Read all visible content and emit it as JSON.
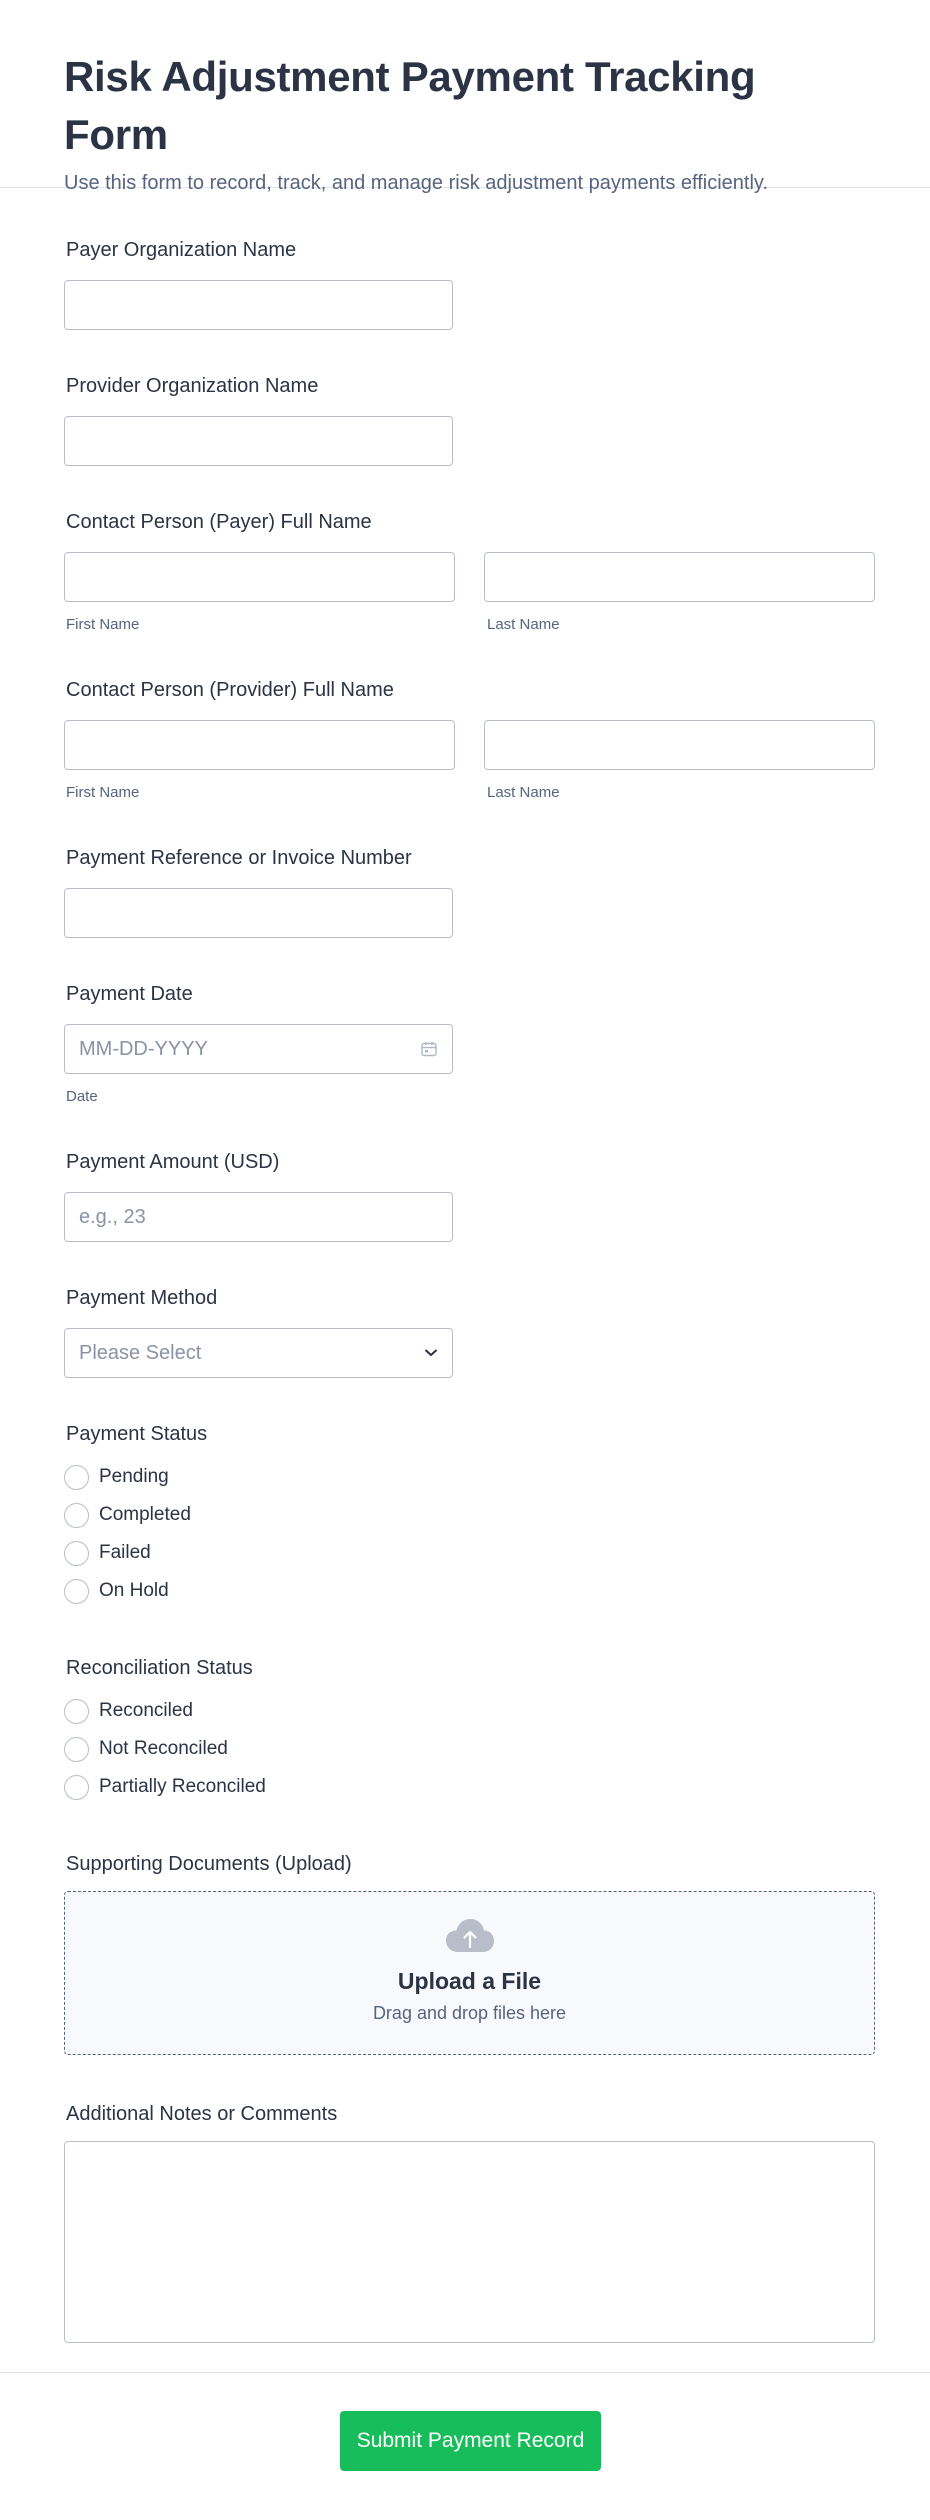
{
  "header": {
    "title": "Risk Adjustment Payment Tracking Form",
    "subtitle": "Use this form to record, track, and manage risk adjustment payments efficiently."
  },
  "fields": {
    "payer_org": {
      "label": "Payer Organization Name",
      "value": ""
    },
    "provider_org": {
      "label": "Provider Organization Name",
      "value": ""
    },
    "payer_contact": {
      "label": "Contact Person (Payer) Full Name",
      "first_sublabel": "First Name",
      "last_sublabel": "Last Name"
    },
    "provider_contact": {
      "label": "Contact Person (Provider) Full Name",
      "first_sublabel": "First Name",
      "last_sublabel": "Last Name"
    },
    "reference": {
      "label": "Payment Reference or Invoice Number",
      "value": ""
    },
    "payment_date": {
      "label": "Payment Date",
      "placeholder": "MM-DD-YYYY",
      "sublabel": "Date",
      "icon": "calendar-icon"
    },
    "amount": {
      "label": "Payment Amount (USD)",
      "placeholder": "e.g., 23"
    },
    "method": {
      "label": "Payment Method",
      "selected": "Please Select",
      "icon": "chevron-down-icon"
    },
    "status": {
      "label": "Payment Status",
      "options": [
        "Pending",
        "Completed",
        "Failed",
        "On Hold"
      ]
    },
    "reconciliation": {
      "label": "Reconciliation Status",
      "options": [
        "Reconciled",
        "Not Reconciled",
        "Partially Reconciled"
      ]
    },
    "upload": {
      "label": "Supporting Documents (Upload)",
      "title": "Upload a File",
      "subtitle": "Drag and drop files here",
      "icon": "cloud-upload-icon"
    },
    "notes": {
      "label": "Additional Notes or Comments",
      "value": ""
    }
  },
  "footer": {
    "submit_label": "Submit Payment Record"
  },
  "colors": {
    "accent": "#18bd5b",
    "text": "#2c3345",
    "muted": "#57647e",
    "border": "#b8bdc9"
  }
}
